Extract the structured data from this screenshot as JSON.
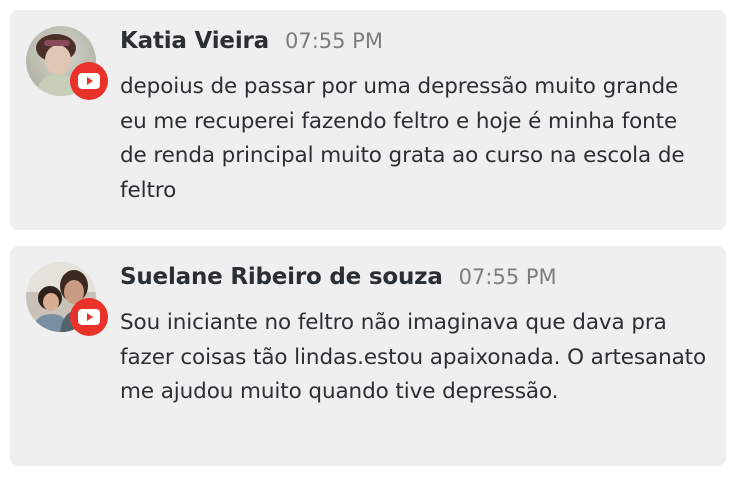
{
  "comments": [
    {
      "author": "Katia Vieira",
      "time": "07:55 PM",
      "text": "depoius de passar por uma depressão muito grande eu me recuperei fazendo feltro e hoje é minha fonte de renda principal muito grata ao curso na escola de feltro",
      "avatar_icon": "user-photo-avatar",
      "badge_icon": "youtube-play-icon",
      "badge_color": "#e8322a"
    },
    {
      "author": "Suelane Ribeiro de souza",
      "time": "07:55 PM",
      "text": "Sou iniciante no feltro não imaginava que dava pra fazer coisas tão lindas.estou apaixonada. O artesanato me ajudou muito quando tive depressão.",
      "avatar_icon": "user-photo-avatar",
      "badge_icon": "youtube-play-icon",
      "badge_color": "#e8322a"
    }
  ],
  "theme": {
    "card_background": "#efefef",
    "author_color": "#2a2f33",
    "time_color": "#7d7d7d"
  }
}
